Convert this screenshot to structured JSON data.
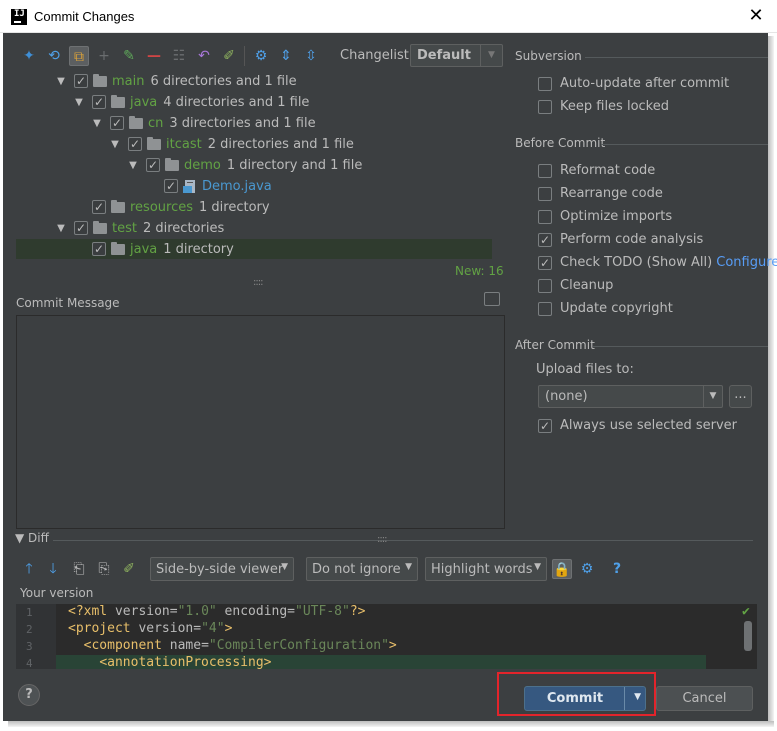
{
  "window": {
    "title": "Commit Changes"
  },
  "toolbar": {
    "changelist_label": "Changelist:",
    "changelist_value": "Default"
  },
  "tree": [
    {
      "name": "main",
      "count": "6 directories and 1 file",
      "color": "green"
    },
    {
      "name": "java",
      "count": "4 directories and 1 file",
      "color": "green"
    },
    {
      "name": "cn",
      "count": "3 directories and 1 file",
      "color": "green"
    },
    {
      "name": "itcast",
      "count": "2 directories and 1 file",
      "color": "green"
    },
    {
      "name": "demo",
      "count": "1 directory and 1 file",
      "color": "green"
    },
    {
      "name": "Demo.java",
      "count": "",
      "color": "blue"
    },
    {
      "name": "resources",
      "count": "1 directory",
      "color": "green"
    },
    {
      "name": "test",
      "count": "2 directories",
      "color": "green"
    },
    {
      "name": "java",
      "count": "1 directory",
      "color": "green"
    }
  ],
  "new_count": "New: 16",
  "commit_message": {
    "label": "Commit Message",
    "value": ""
  },
  "subversion": {
    "header": "Subversion",
    "options": [
      {
        "label": "Auto-update after commit",
        "checked": false
      },
      {
        "label": "Keep files locked",
        "checked": false
      }
    ]
  },
  "before_commit": {
    "header": "Before Commit",
    "options": [
      {
        "label": "Reformat code",
        "checked": false
      },
      {
        "label": "Rearrange code",
        "checked": false
      },
      {
        "label": "Optimize imports",
        "checked": false
      },
      {
        "label": "Perform code analysis",
        "checked": true
      },
      {
        "label": "Check TODO (Show All)",
        "checked": true,
        "link": "Configure"
      },
      {
        "label": "Cleanup",
        "checked": false
      },
      {
        "label": "Update copyright",
        "checked": false
      }
    ]
  },
  "after_commit": {
    "header": "After Commit",
    "upload_label": "Upload files to:",
    "upload_value": "(none)",
    "more_label": "...",
    "always_use": {
      "label": "Always use selected server",
      "checked": true
    }
  },
  "diff": {
    "label": "Diff",
    "viewer": "Side-by-side viewer",
    "ignore": "Do not ignore",
    "highlight": "Highlight words",
    "your_version": "Your version",
    "line_numbers": [
      "1",
      "2",
      "3",
      "4"
    ]
  },
  "buttons": {
    "help": "?",
    "commit": "Commit",
    "cancel": "Cancel"
  },
  "colors": {
    "background": "#3c3f41",
    "accent_green": "#62a244",
    "link_blue": "#589df6",
    "commit_blue": "#365880",
    "highlight_red": "#e3242b"
  }
}
